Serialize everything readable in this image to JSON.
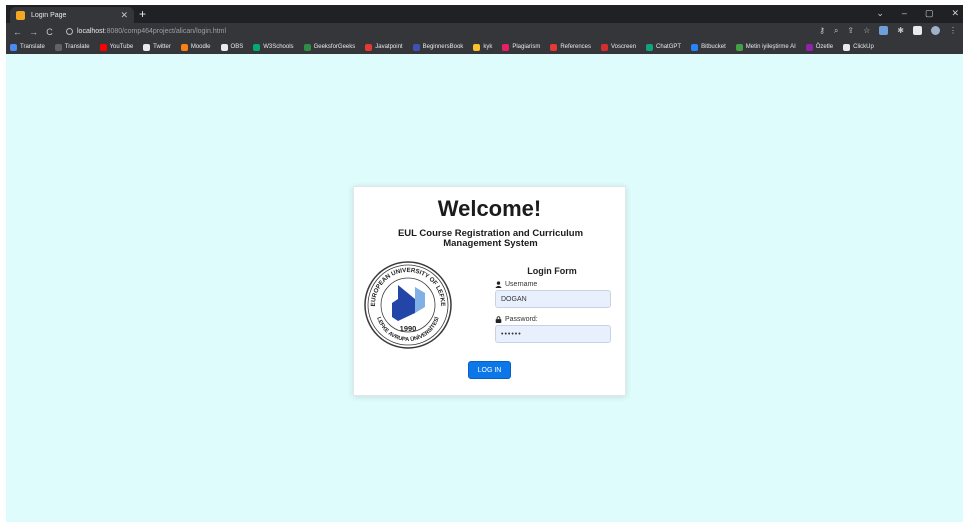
{
  "browser": {
    "tab_title": "Login Page",
    "tab_close": "✕",
    "new_tab": "+",
    "window_controls": [
      "⌄",
      "–",
      "▢",
      "✕"
    ],
    "nav": {
      "back": "←",
      "forward": "→",
      "reload": "C"
    },
    "url_host": "localhost",
    "url_path": ":8080/comp464project/alican/login.html",
    "bookmarks": [
      {
        "label": "Translate",
        "color": "#4a8af4"
      },
      {
        "label": "Translate",
        "color": "#5f6368"
      },
      {
        "label": "YouTube",
        "color": "#ff0000"
      },
      {
        "label": "Twitter",
        "color": "#e8eaed"
      },
      {
        "label": "Moodle",
        "color": "#f98012"
      },
      {
        "label": "OBS",
        "color": "#e8eaed"
      },
      {
        "label": "W3Schools",
        "color": "#04aa6d"
      },
      {
        "label": "GeeksforGeeks",
        "color": "#2f8d46"
      },
      {
        "label": "Javatpoint",
        "color": "#e53935"
      },
      {
        "label": "BeginnersBook",
        "color": "#3f51b5"
      },
      {
        "label": "kyk",
        "color": "#fbc02d"
      },
      {
        "label": "Plagiarism",
        "color": "#e91e63"
      },
      {
        "label": "References",
        "color": "#e53935"
      },
      {
        "label": "Voscreen",
        "color": "#d32f2f"
      },
      {
        "label": "ChatGPT",
        "color": "#10a37f"
      },
      {
        "label": "Bitbucket",
        "color": "#2684ff"
      },
      {
        "label": "Metin iyileştirme AI",
        "color": "#43a047"
      },
      {
        "label": "Özetle",
        "color": "#8e24aa"
      },
      {
        "label": "ClickUp",
        "color": "#e8eaed"
      }
    ]
  },
  "login": {
    "welcome": "Welcome!",
    "subtitle": "EUL Course Registration and Curriculum Management System",
    "form_title": "Login Form",
    "username_label": "Username",
    "username_value": "DOGAN",
    "password_label": "Password:",
    "password_value": "••••••",
    "button_label": "LOG IN"
  },
  "seal": {
    "top_text": "EUROPEAN UNIVERSITY OF LEFKE",
    "bottom_text": "LEFKE AVRUPA ÜNİVERSİTESİ",
    "year": "1990"
  },
  "colors": {
    "page_background": "#defcfc",
    "button": "#0b77e8",
    "input_background": "#e8f0fe"
  }
}
